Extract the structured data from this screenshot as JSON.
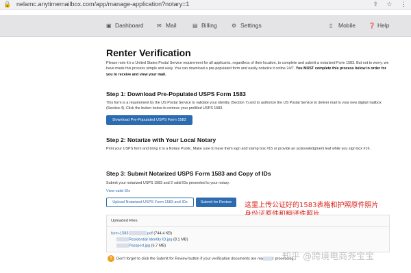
{
  "browser": {
    "url": "nelamc.anytimemailbox.com/app/manage-application?notary=1"
  },
  "nav": {
    "items": [
      {
        "label": "Dashboard",
        "icon": "dashboard-icon"
      },
      {
        "label": "Mail",
        "icon": "mail-icon"
      },
      {
        "label": "Billing",
        "icon": "billing-icon"
      },
      {
        "label": "Settings",
        "icon": "settings-icon"
      },
      {
        "label": "Mobile",
        "icon": "mobile-icon"
      },
      {
        "label": "Help",
        "icon": "help-icon"
      }
    ]
  },
  "page": {
    "title": "Renter Verification",
    "intro": "Please note it's a United States Postal Service requirement for all applicants, regardless of their location, to complete and submit a notarized Form 1583. But not to worry, we have made this process simple and easy. You can download a pre-populated form and easily notarize it online 24/7.",
    "intro_bold": "You MUST complete this process below in order for you to receive and view your mail."
  },
  "step1": {
    "heading": "Step 1: Download Pre-Populated USPS Form 1583",
    "text": "This form is a requirement by the US Postal Service to validate your identity (Section 7) and to authorize the US Postal Service to deliver mail to your new digital mailbox (Section 4). Click the button below to retrieve your prefilled USPS 1583.",
    "button": "Download Pre-Populated USPS Form 1583"
  },
  "step2": {
    "heading": "Step 2: Notarize with Your Local Notary",
    "text": "Print your USPS form and bring it to a Notary Public. Make sure to have them sign and stamp box #15 or provide an acknowledgment leaf while you sign box #16."
  },
  "step3": {
    "heading": "Step 3: Submit Notarized USPS Form 1583 and Copy of IDs",
    "text": "Submit your notarized USPS 1583 and 2 valid IDs presented to your notary.",
    "view_ids_link": "View valid IDs",
    "upload_button": "Upload Notarized USPS Form 1583 and IDs",
    "submit_button": "Submit for Review"
  },
  "annotation": {
    "line1": "这里上传公证好的1583表格和护照原件照片",
    "line2": "身份证原件和翻译件照片"
  },
  "uploaded": {
    "heading": "Uploaded Files",
    "files": [
      {
        "name_prefix": "form-1583",
        "name_suffix": ".pdf",
        "size": "(744.4 KB)"
      },
      {
        "name_prefix": "",
        "name_suffix": "Residential Identity ID.jpg",
        "size": "(8.1 MB)"
      },
      {
        "name_prefix": "",
        "name_suffix": "Passport.jpg",
        "size": "(6.7 MB)"
      }
    ]
  },
  "warning": {
    "text": "Don't forget to click the Submit for Review button if your verification documents are rea",
    "tail": "r processing."
  },
  "watermark": "知乎 @跨境电商尧宝宝"
}
